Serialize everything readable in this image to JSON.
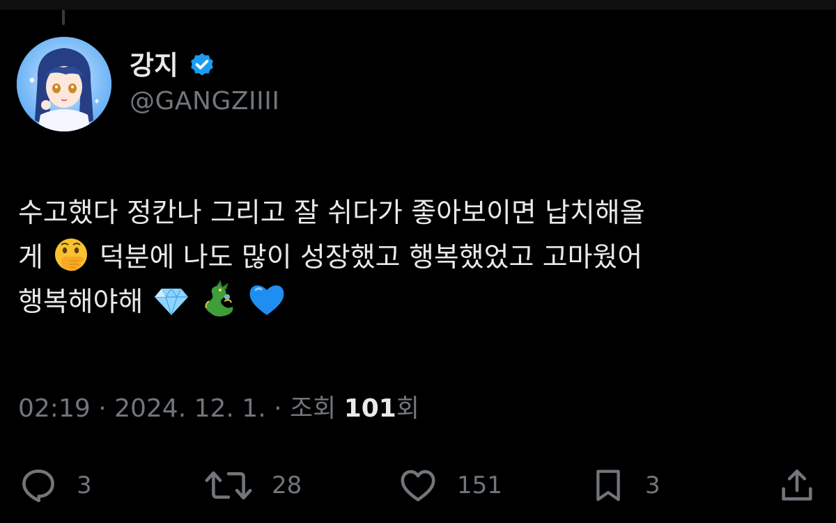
{
  "author": {
    "display_name": "강지",
    "handle": "@GANGZIIII",
    "verified": true,
    "avatar_icon": "anime-girl-avatar"
  },
  "tweet": {
    "lines": [
      {
        "text_before": "수고했다 정칸나 그리고 잘 쉬다가 좋아보이면 납치해올",
        "emoji": null,
        "text_after": ""
      },
      {
        "text_before": "게",
        "emoji": "face-with-hand-over-mouth",
        "text_after": " 덕분에 나도 많이 성장했고 행복했었고 고마웠어"
      },
      {
        "text_before": "행복해야해",
        "emoji": null,
        "text_after": ""
      }
    ],
    "trailing_emojis": [
      "gem-stone",
      "dragon",
      "blue-heart"
    ]
  },
  "meta": {
    "time": "02:19",
    "separator": " · ",
    "date": "2024. 12. 1.",
    "views_label": "조회",
    "views_count": "101",
    "views_suffix": "회"
  },
  "actions": {
    "reply_count": "3",
    "retweet_count": "28",
    "like_count": "151",
    "bookmark_count": "3"
  },
  "colors": {
    "background": "#000000",
    "text_primary": "#e7e9ea",
    "text_secondary": "#71767b",
    "verified_blue": "#1d9bf0"
  }
}
